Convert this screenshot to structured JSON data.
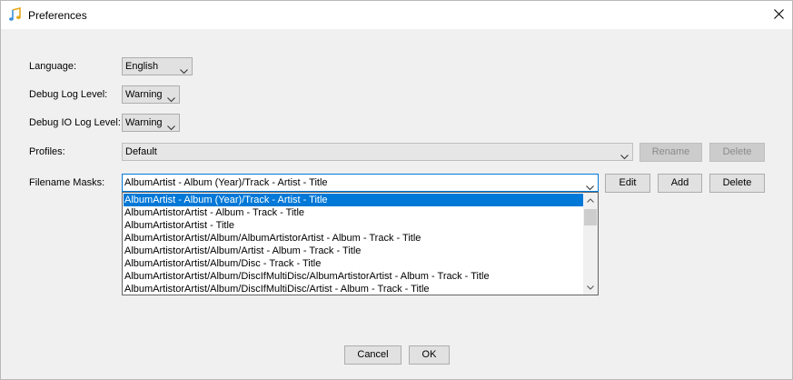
{
  "window": {
    "title": "Preferences"
  },
  "form": {
    "language": {
      "label": "Language:",
      "value": "English"
    },
    "debug_log_level": {
      "label": "Debug Log Level:",
      "value": "Warning"
    },
    "debug_io_log_level": {
      "label": "Debug IO Log Level:",
      "value": "Warning"
    },
    "profiles": {
      "label": "Profiles:",
      "value": "Default",
      "rename_label": "Rename",
      "delete_label": "Delete"
    },
    "filename_masks": {
      "label": "Filename Masks:",
      "value": "AlbumArtist - Album (Year)/Track - Artist - Title",
      "edit_label": "Edit",
      "add_label": "Add",
      "delete_label": "Delete",
      "options": [
        "AlbumArtist - Album (Year)/Track - Artist - Title",
        "AlbumArtistorArtist - Album - Track - Title",
        "AlbumArtistorArtist - Title",
        "AlbumArtistorArtist/Album/AlbumArtistorArtist - Album - Track - Title",
        "AlbumArtistorArtist/Album/Artist - Album - Track - Title",
        "AlbumArtistorArtist/Album/Disc - Track - Title",
        "AlbumArtistorArtist/Album/DiscIfMultiDisc/AlbumArtistorArtist - Album - Track - Title",
        "AlbumArtistorArtist/Album/DiscIfMultiDisc/Artist - Album - Track - Title"
      ]
    }
  },
  "footer": {
    "cancel_label": "Cancel",
    "ok_label": "OK"
  },
  "colors": {
    "accent": "#0078d7",
    "background": "#f0f0f0"
  }
}
